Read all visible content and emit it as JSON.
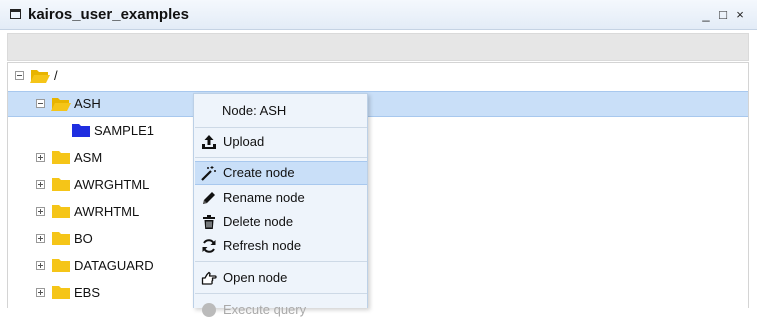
{
  "window": {
    "title": "kairos_user_examples",
    "controls": [
      "_",
      "□",
      "×"
    ]
  },
  "tree": {
    "root": {
      "label": "/"
    },
    "items": [
      {
        "label": "ASH",
        "expanded": true,
        "selected": true
      },
      {
        "label": "SAMPLE1",
        "child": true
      },
      {
        "label": "ASM"
      },
      {
        "label": "AWRGHTML"
      },
      {
        "label": "AWRHTML"
      },
      {
        "label": "BO"
      },
      {
        "label": "DATAGUARD"
      },
      {
        "label": "EBS"
      }
    ]
  },
  "context_menu": {
    "header": "Node: ASH",
    "items": [
      {
        "label": "Upload",
        "icon": "upload-icon"
      },
      {
        "label": "Create node",
        "icon": "magic-wand-icon",
        "highlighted": true
      },
      {
        "label": "Rename node",
        "icon": "pencil-icon"
      },
      {
        "label": "Delete node",
        "icon": "trash-icon"
      },
      {
        "label": "Refresh node",
        "icon": "refresh-icon"
      },
      {
        "label": "Open node",
        "icon": "hand-pointer-icon"
      },
      {
        "label": "Execute query",
        "icon": "help-icon",
        "disabled": true
      }
    ]
  },
  "colors": {
    "folder": "#f5c518",
    "folder_child": "#1f2ee0",
    "selection": "#c9dff8"
  }
}
